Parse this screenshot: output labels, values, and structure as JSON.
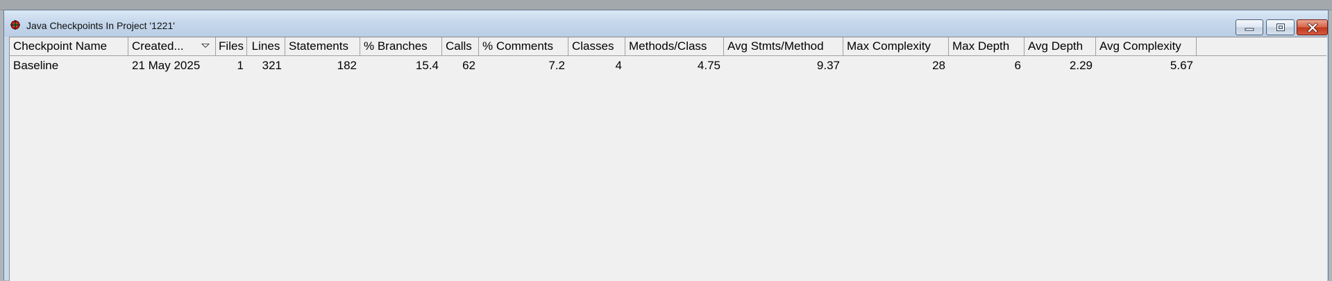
{
  "window": {
    "title": "Java Checkpoints In Project '1221'"
  },
  "table": {
    "columns": [
      "Checkpoint Name",
      "Created...",
      "Files",
      "Lines",
      "Statements",
      "% Branches",
      "Calls",
      "% Comments",
      "Classes",
      "Methods/Class",
      "Avg Stmts/Method",
      "Max Complexity",
      "Max Depth",
      "Avg Depth",
      "Avg Complexity"
    ],
    "sorted_column": "Created...",
    "rows": [
      [
        "Baseline",
        "21 May 2025",
        "1",
        "321",
        "182",
        "15.4",
        "62",
        "7.2",
        "4",
        "4.75",
        "9.37",
        "28",
        "6",
        "2.29",
        "5.67"
      ]
    ]
  },
  "icons": {
    "app": "checkpoint-target-icon",
    "sort": "sort-descending-icon",
    "minimize": "minimize-icon",
    "maximize": "maximize-icon",
    "close": "close-icon"
  },
  "colors": {
    "titlebar": "#c6d8ec",
    "client_background": "#f0f0f0",
    "close_button": "#c2391c"
  }
}
